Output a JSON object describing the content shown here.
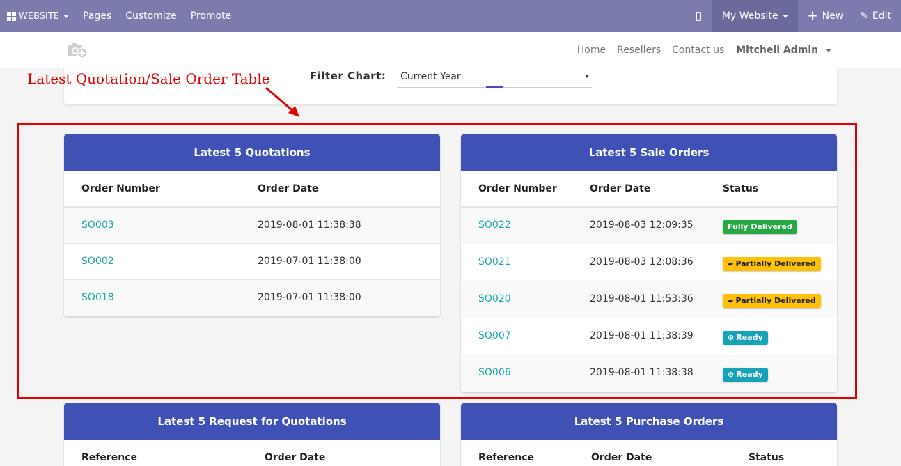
{
  "topbar": {
    "website_label": "WEBSITE",
    "pages": "Pages",
    "customize": "Customize",
    "promote": "Promote",
    "my_website": "My Website",
    "new": "New",
    "edit": "Edit"
  },
  "navbar": {
    "links": [
      "Home",
      "Resellers",
      "Contact us"
    ],
    "user": "Mitchell Admin"
  },
  "filter": {
    "label": "Filter Chart:",
    "value": "Current Year"
  },
  "annotation": "Latest Quotation/Sale Order Table",
  "quotations": {
    "title": "Latest 5 Quotations",
    "columns": [
      "Order Number",
      "Order Date"
    ],
    "rows": [
      {
        "order": "SO003",
        "date": "2019-08-01 11:38:38"
      },
      {
        "order": "SO002",
        "date": "2019-07-01 11:38:00"
      },
      {
        "order": "SO018",
        "date": "2019-07-01 11:38:00"
      }
    ]
  },
  "sale_orders": {
    "title": "Latest 5 Sale Orders",
    "columns": [
      "Order Number",
      "Order Date",
      "Status"
    ],
    "rows": [
      {
        "order": "SO022",
        "date": "2019-08-03 12:09:35",
        "status": "Fully Delivered"
      },
      {
        "order": "SO021",
        "date": "2019-08-03 12:08:36",
        "status": "Partially Delivered"
      },
      {
        "order": "SO020",
        "date": "2019-08-01 11:53:36",
        "status": "Partially Delivered"
      },
      {
        "order": "SO007",
        "date": "2019-08-01 11:38:39",
        "status": "Ready"
      },
      {
        "order": "SO006",
        "date": "2019-08-01 11:38:38",
        "status": "Ready"
      }
    ]
  },
  "rfq": {
    "title": "Latest 5 Request for Quotations",
    "columns": [
      "Reference",
      "Order Date"
    ]
  },
  "purchase_orders": {
    "title": "Latest 5 Purchase Orders",
    "columns": [
      "Reference",
      "Order Date",
      "Status"
    ]
  },
  "colors": {
    "topbar": "#7c7bad",
    "card_header": "#3f51b5",
    "link": "#1aa6a6",
    "annotation": "#e60000"
  }
}
